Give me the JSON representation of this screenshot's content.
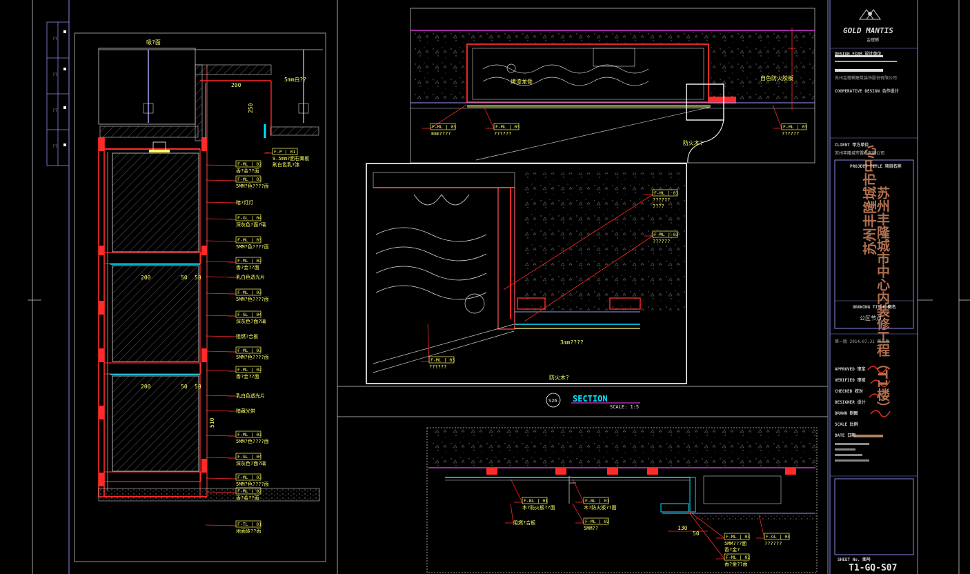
{
  "colors": {
    "background": "#000000",
    "frame": "#8a8ae6",
    "wall": "#ff2a2a",
    "callout": "#ffff66",
    "accent_cyan": "#00e5ff",
    "title_brown": "#b07050",
    "signature": "#e03020"
  },
  "left_elevation": {
    "top_label": "吸?面",
    "ceiling_note": "5mm白??",
    "dims": [
      "200",
      "250",
      "50",
      "50",
      "200",
      "50",
      "50",
      "510"
    ],
    "callouts": [
      {
        "tag": "F-P | 01",
        "text": "9.5mm?面石膏板\n刷白色乳?漆"
      },
      {
        "tag": "F-ML | 02",
        "text": "香?金??面"
      },
      {
        "tag": "F-ML | 03",
        "text": "5MM?色????面"
      },
      {
        "tag": "",
        "text": "暗?灯灯"
      },
      {
        "tag": "F-GL | 04",
        "text": "深灰色?面?璃"
      },
      {
        "tag": "F-ML | 03",
        "text": "5MM?色????面"
      },
      {
        "tag": "F-ML | 02",
        "text": "香?金??面"
      },
      {
        "tag": "",
        "text": "乳白色透光片"
      },
      {
        "tag": "F-ML | 03",
        "text": "5MM?色????面"
      },
      {
        "tag": "F-GL | 04",
        "text": "深灰色?面?璃"
      },
      {
        "tag": "",
        "text": "阻燃?合板"
      },
      {
        "tag": "F-ML | 03",
        "text": "5MM?色????面"
      },
      {
        "tag": "F-ML | 02",
        "text": "香?金??面"
      },
      {
        "tag": "",
        "text": "乳白色透光片"
      },
      {
        "tag": "",
        "text": "暗藏光带"
      },
      {
        "tag": "F-ML | 03",
        "text": "5MM?色????面"
      },
      {
        "tag": "F-GL | 04",
        "text": "深灰色?面?璃"
      },
      {
        "tag": "F-ML | 03",
        "text": "5MM?色????面"
      },
      {
        "tag": "F-ML | 02",
        "text": "香?金??面"
      },
      {
        "tag": "F-TL | 01",
        "text": "地面砖??面"
      }
    ]
  },
  "top_detail": {
    "labels": [
      "烤漆龙骨",
      "自色防火胶板",
      "防火木?"
    ],
    "callouts": [
      {
        "tag": "F-ML | 03",
        "text": "3mm????"
      },
      {
        "tag": "F-ML | 03",
        "text": "??????"
      },
      {
        "tag": "F-ML | 03",
        "text": "??????"
      }
    ]
  },
  "enlarged_detail": {
    "callouts": [
      {
        "tag": "F-ML | 03",
        "text": "??????\n????"
      },
      {
        "tag": "F-ML | 03",
        "text": "??????"
      },
      {
        "tag": "F-ML | 03",
        "text": "??????"
      }
    ],
    "note": "3mm????",
    "bottom_label": "防火木?"
  },
  "section_title": {
    "number": "S26",
    "title": "SECTION",
    "scale": "SCALE: 1:5"
  },
  "bottom_detail": {
    "dims": [
      "130",
      "50"
    ],
    "callouts": [
      {
        "tag": "F-BL | 01",
        "text": "木?防火板??面"
      },
      {
        "tag": "F-BL | 01",
        "text": "木?防火板??面"
      },
      {
        "tag": "",
        "text": "阻燃?合板"
      },
      {
        "tag": "F-ML | 02",
        "text": "5MM??"
      },
      {
        "tag": "F-ML | 03",
        "text": "5MM???面\n香?金?"
      },
      {
        "tag": "F-GL | 04",
        "text": "??????"
      },
      {
        "tag": "F-ML | 02",
        "text": "香?金??面"
      }
    ]
  },
  "title_block": {
    "logo_text": "GOLD MANTIS",
    "logo_sub": "金螳螂",
    "design_firm_label": "DESIGN FIRM  设计单位",
    "firm_line": "苏州金螳螂建筑装饰股份有限公司",
    "cooperative_label": "COOPERATIVE DESIGN  合作设计",
    "client_label": "CLIENT  甲方单位",
    "client_name": "苏州丰隆城市置业有限公司",
    "project_label": "PROJECT TITLE  项目名称",
    "project_name_line1": "苏州丰隆城市中心",
    "project_name_line2": "内装修工程（T1楼）",
    "drawing_title_label": "DRAWING TITLE  图名",
    "drawing_title": "公区节点",
    "version_line": "第一版  2014.07.31  第二版",
    "roles": [
      "APPROVED  审定",
      "VERIFIED  审核",
      "CHECKED  校对",
      "DESIGNER  设计",
      "DRAWN  制图",
      "SCALE  比例",
      "DATE  日期"
    ],
    "sheet_no_label": "SHEET No.  图号",
    "sheet_no": "T1-GQ-S07"
  },
  "left_strip": {
    "cells": [
      "??",
      "??",
      "??",
      "??"
    ]
  }
}
